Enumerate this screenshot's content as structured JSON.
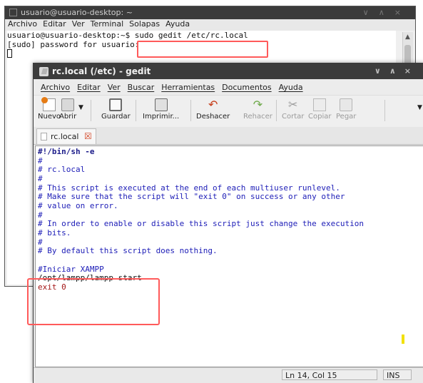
{
  "terminal": {
    "title": "usuario@usuario-desktop: ~",
    "menu": [
      "Archivo",
      "Editar",
      "Ver",
      "Terminal",
      "Solapas",
      "Ayuda"
    ],
    "lines": [
      "usuario@usuario-desktop:~$ sudo gedit /etc/rc.local",
      "[sudo] password for usuario:"
    ]
  },
  "gedit": {
    "title": "rc.local (/etc) - gedit",
    "menu": [
      "Archivo",
      "Editar",
      "Ver",
      "Buscar",
      "Herramientas",
      "Documentos",
      "Ayuda"
    ],
    "toolbar": {
      "new": "Nuevo",
      "open": "Abrir",
      "save": "Guardar",
      "print": "Imprimir...",
      "undo": "Deshacer",
      "redo": "Rehacer",
      "cut": "Cortar",
      "copy": "Copiar",
      "paste": "Pegar"
    },
    "tab": {
      "label": "rc.local"
    },
    "code_lines": [
      "#!/bin/sh -e",
      "#",
      "# rc.local",
      "#",
      "# This script is executed at the end of each multiuser runlevel.",
      "# Make sure that the script will \"exit 0\" on success or any other",
      "# value on error.",
      "#",
      "# In order to enable or disable this script just change the execution",
      "# bits.",
      "#",
      "# By default this script does nothing.",
      "",
      "#Iniciar XAMPP",
      "/opt/lampp/lampp start",
      "exit 0"
    ],
    "status": {
      "position": "Ln 14, Col 15",
      "mode": "INS"
    }
  },
  "colors": {
    "highlight": "#ff5a5a",
    "comment": "#2020b8",
    "caret": "#f2e100"
  }
}
